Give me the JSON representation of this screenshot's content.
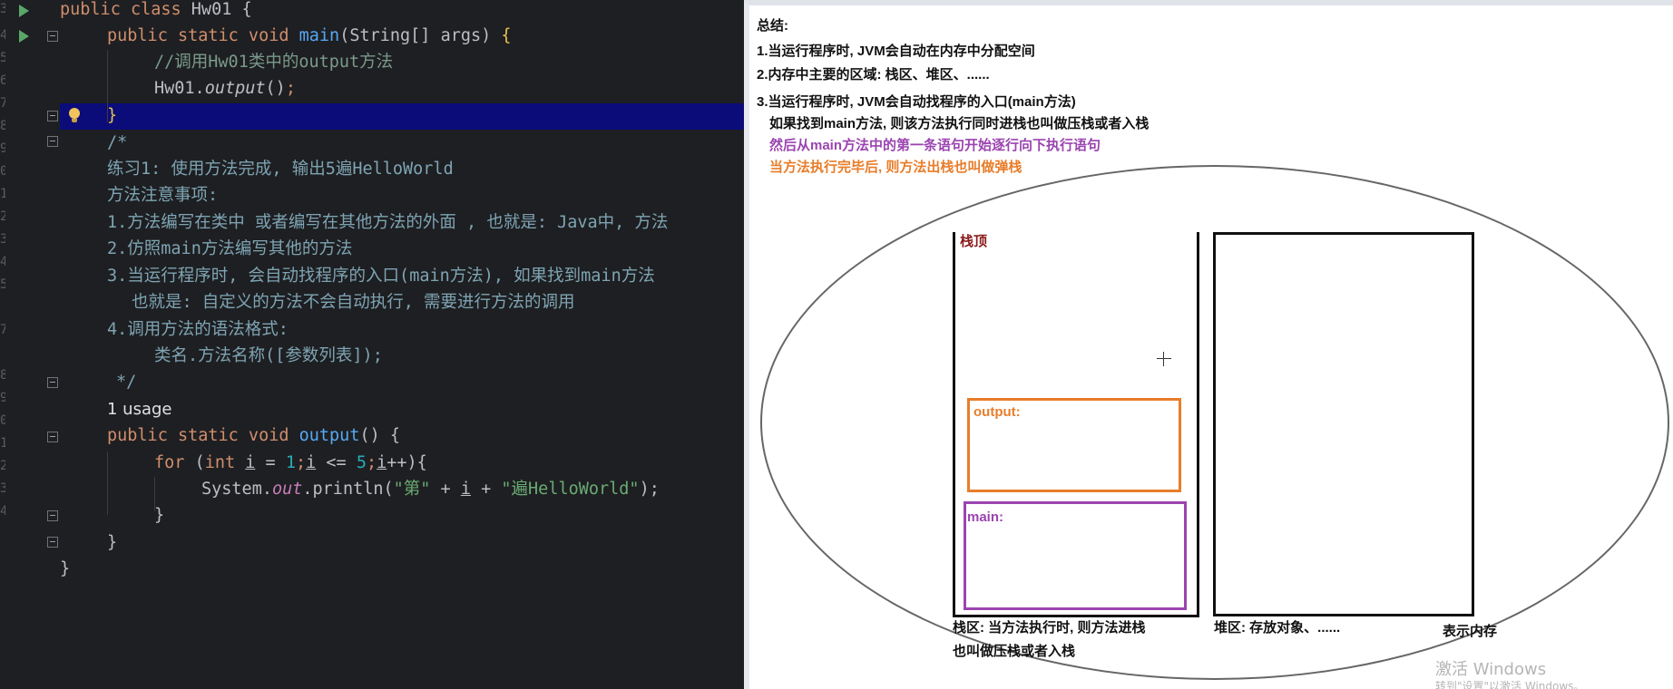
{
  "editor": {
    "line_numbers": [
      "3",
      "4",
      "5",
      "6",
      "7",
      "8",
      "9",
      "0",
      "1",
      "2",
      "3",
      "4",
      "5",
      "7",
      "8",
      "9",
      "0",
      "1",
      "2",
      "3",
      "4"
    ],
    "lines": {
      "l1": {
        "k1": "public class ",
        "t": "Hw01 {"
      },
      "l2": {
        "k1": "public static void ",
        "f": "main",
        "p": "(String[] args) ",
        "b": "{"
      },
      "l3": {
        "c": "//调用Hw01类中的output方法"
      },
      "l4": {
        "t1": "Hw01.",
        "m": "output",
        "t2": "()",
        "s": ";"
      },
      "l5": {
        "b": "}"
      },
      "l6": {
        "d": "/*"
      },
      "l7": {
        "d": "练习1: 使用方法完成, 输出5遍HelloWorld"
      },
      "l8": {
        "d": "方法注意事项:"
      },
      "l9": {
        "d": "1.方法编写在类中 或者编写在其他方法的外面 , 也就是: Java中, 方法"
      },
      "l10": {
        "d": "2.仿照main方法编写其他的方法"
      },
      "l11": {
        "d": "3.当运行程序时, 会自动找程序的入口(main方法), 如果找到main方法"
      },
      "l12": {
        "d": "也就是: 自定义的方法不会自动执行, 需要进行方法的调用"
      },
      "l13": {
        "d": "4.调用方法的语法格式:"
      },
      "l14": {
        "d": "类名.方法名称([参数列表]);"
      },
      "l15": {
        "d": "*/"
      },
      "usage": "1 usage",
      "l16": {
        "k1": "public static void ",
        "f": "output",
        "p": "() {"
      },
      "l17": {
        "k1": "for ",
        "p1": "(",
        "k2": "int ",
        "v1": "i",
        "p2": " = ",
        "n1": "1",
        "p3": ";",
        "v2": "i",
        "p4": " <= ",
        "n2": "5",
        "p5": ";",
        "v3": "i",
        "p6": "++){"
      },
      "l18": {
        "t1": "System.",
        "o": "out",
        "t2": ".println(",
        "s1": "\"第\"",
        "t3": " + ",
        "v": "i",
        "t4": " + ",
        "s2": "\"遍HelloWorld\"",
        "t5": ");"
      },
      "l19": {
        "b": "}"
      },
      "l20": {
        "b": "}"
      },
      "l21": {
        "b": "}"
      }
    }
  },
  "slide": {
    "summary_title": "总结:",
    "point1": "1.当运行程序时, JVM会自动在内存中分配空间",
    "point2": "2.内存中主要的区域: 栈区、堆区、......",
    "point3": "3.当运行程序时, JVM会自动找程序的入口(main方法)",
    "point3_sub1": "如果找到main方法, 则该方法执行同时进栈也叫做压栈或者入栈",
    "point3_sub2": "然后从main方法中的第一条语句开始逐行向下执行语句",
    "point3_sub3": "当方法执行完毕后, 则方法出栈也叫做弹栈",
    "stack_top_label": "栈顶",
    "frame_output_label": "output:",
    "frame_main_label": "main:",
    "stack_caption_line1": "栈区: 当方法执行时, 则方法进栈",
    "stack_caption_line2": "也叫做压栈或者入栈",
    "heap_caption": "堆区: 存放对象、......",
    "memory_caption": "表示内存",
    "watermark_line1": "激活 Windows",
    "watermark_line2": "转到\"设置\"以激活 Windows。"
  },
  "colors": {
    "editor_bg": "#1e1f22",
    "current_line": "#0b0c7a",
    "keyword": "#cf8e6d",
    "function": "#56a8f5",
    "string": "#6aab73",
    "number": "#2aacb8",
    "slide_purple": "#9b44b0",
    "slide_orange": "#e87d2a",
    "slide_darkred": "#8b1a1a"
  },
  "icons": [
    "run-icon",
    "fold-icon",
    "bulb-icon",
    "crosshair-cursor-icon"
  ]
}
